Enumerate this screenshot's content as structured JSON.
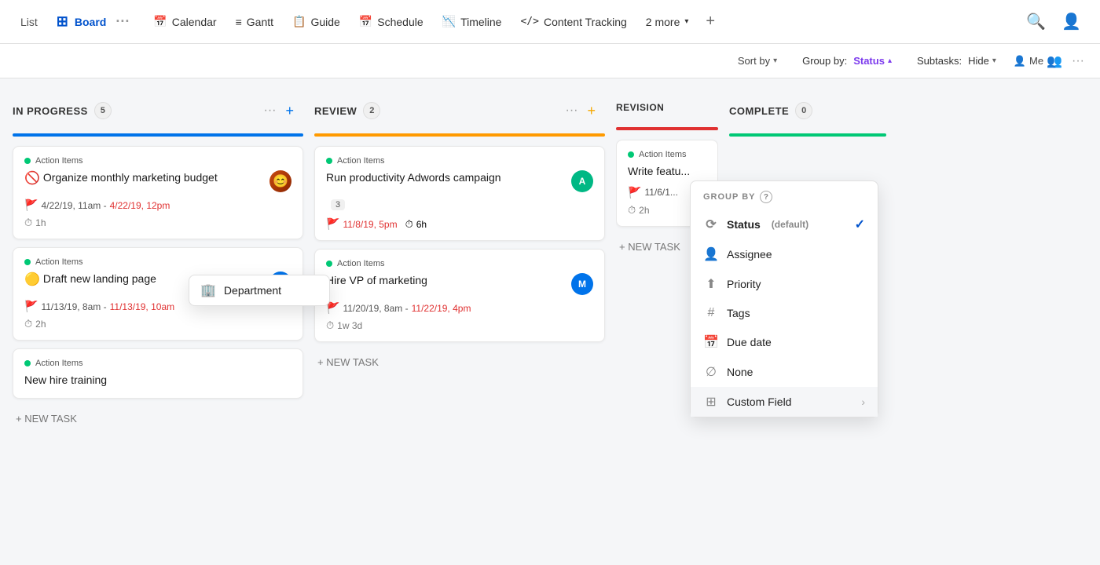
{
  "nav": {
    "active_tab": "Board",
    "tabs": [
      {
        "id": "board",
        "label": "Board",
        "icon": "⊞"
      },
      {
        "id": "calendar",
        "label": "Calendar",
        "icon": "📅"
      },
      {
        "id": "gantt",
        "label": "Gantt",
        "icon": "📊"
      },
      {
        "id": "guide",
        "label": "Guide",
        "icon": "📋"
      },
      {
        "id": "schedule",
        "label": "Schedule",
        "icon": "📅"
      },
      {
        "id": "timeline",
        "label": "Timeline",
        "icon": "📉"
      },
      {
        "id": "content-tracking",
        "label": "Content Tracking",
        "icon": "</>"
      }
    ],
    "more_label": "2 more",
    "plus_label": "+"
  },
  "toolbar": {
    "sort_by_label": "Sort by",
    "group_by_label": "Group by:",
    "group_by_value": "Status",
    "subtasks_label": "Subtasks:",
    "subtasks_value": "Hide",
    "me_label": "Me",
    "person_icon": "👤"
  },
  "dropdown": {
    "title": "GROUP BY",
    "help": "?",
    "items": [
      {
        "id": "status",
        "label": "Status",
        "suffix": "(default)",
        "selected": true,
        "icon": "⟳"
      },
      {
        "id": "assignee",
        "label": "Assignee",
        "selected": false
      },
      {
        "id": "priority",
        "label": "Priority",
        "selected": false
      },
      {
        "id": "tags",
        "label": "Tags",
        "selected": false
      },
      {
        "id": "due-date",
        "label": "Due date",
        "selected": false
      },
      {
        "id": "none",
        "label": "None",
        "selected": false
      },
      {
        "id": "custom-field",
        "label": "Custom Field",
        "has_submenu": true,
        "selected": false
      }
    ],
    "submenu_item": {
      "label": "Department",
      "icon": "🏢"
    }
  },
  "columns": [
    {
      "id": "in-progress",
      "title": "IN PROGRESS",
      "count": "5",
      "bar_color": "bar-blue",
      "menu_icon": "···",
      "add_icon": "+",
      "tasks": [
        {
          "id": "t1",
          "label": "Action Items",
          "title": "Organize monthly marketing budget",
          "has_avatar": true,
          "avatar_type": "photo",
          "avatar_bg": "#c84b11",
          "avatar_text": "",
          "has_warning": true,
          "warning_icon": "🚫",
          "dates": "4/22/19, 11am -",
          "dates_overdue": "4/22/19, 12pm",
          "time": "1h",
          "sub_count": null
        },
        {
          "id": "t2",
          "label": "Action Items",
          "title": "Draft new landing page",
          "has_avatar": true,
          "avatar_type": "letter",
          "avatar_bg": "#0052cc",
          "avatar_text": "M",
          "has_warning": false,
          "warning_icon": "🟡",
          "dates": "11/13/19, 8am -",
          "dates_overdue": "11/13/19, 10am",
          "time": "2h",
          "sub_count": null
        },
        {
          "id": "t3",
          "label": "Action Items",
          "title": "New hire training",
          "has_avatar": false,
          "avatar_type": null,
          "avatar_bg": null,
          "avatar_text": "",
          "has_warning": false,
          "warning_icon": "",
          "dates": null,
          "dates_overdue": null,
          "time": null,
          "sub_count": null
        }
      ],
      "new_task_label": "+ NEW TASK"
    },
    {
      "id": "review",
      "title": "REVIEW",
      "count": "2",
      "bar_color": "bar-orange",
      "menu_icon": "···",
      "add_icon": "+",
      "tasks": [
        {
          "id": "t4",
          "label": "Action Items",
          "title": "Run productivity Adwords campaign",
          "has_avatar": true,
          "avatar_type": "letter",
          "avatar_bg": "#00b884",
          "avatar_text": "A",
          "has_warning": false,
          "warning_icon": "",
          "sub_badge": "3",
          "dates": "11/8/19, 5pm",
          "dates_overdue": null,
          "time": "6h",
          "sub_count": "3"
        },
        {
          "id": "t5",
          "label": "Action Items",
          "title": "Hire VP of marketing",
          "has_avatar": true,
          "avatar_type": "letter",
          "avatar_bg": "#0052cc",
          "avatar_text": "M",
          "has_warning": false,
          "warning_icon": "",
          "dates": "11/20/19, 8am -",
          "dates_overdue": "11/22/19, 4pm",
          "time": "1w 3d",
          "sub_count": null
        }
      ],
      "new_task_label": "+ NEW TASK"
    },
    {
      "id": "revision",
      "title": "REVISION",
      "count": "",
      "bar_color": "bar-red",
      "tasks": [
        {
          "id": "t6",
          "label": "Action Items",
          "title": "Write featu...",
          "has_avatar": false,
          "dates": "11/6/1...",
          "time": "2h"
        }
      ],
      "new_task_label": "+ NEW TASK"
    },
    {
      "id": "complete",
      "title": "COMPLETE",
      "count": "0",
      "bar_color": "bar-green",
      "tasks": [],
      "new_task_label": ""
    }
  ]
}
